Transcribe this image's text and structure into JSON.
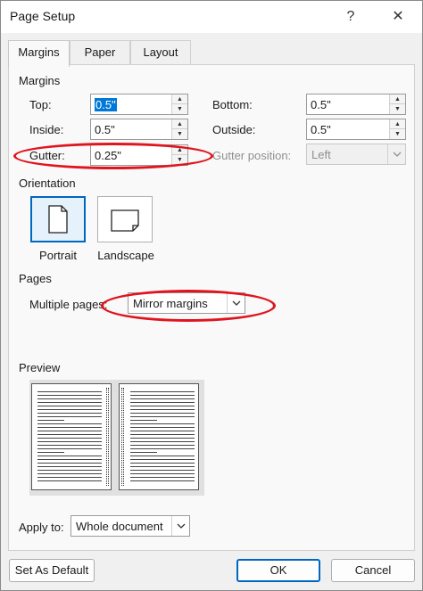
{
  "window": {
    "title": "Page Setup",
    "help_label": "?",
    "close_label": "✕"
  },
  "tabs": [
    {
      "label": "Margins",
      "active": true
    },
    {
      "label": "Paper",
      "active": false
    },
    {
      "label": "Layout",
      "active": false
    }
  ],
  "margins": {
    "section_label": "Margins",
    "top": {
      "label": "Top:",
      "value": "0.5\""
    },
    "bottom": {
      "label": "Bottom:",
      "value": "0.5\""
    },
    "inside": {
      "label": "Inside:",
      "value": "0.5\""
    },
    "outside": {
      "label": "Outside:",
      "value": "0.5\""
    },
    "gutter": {
      "label": "Gutter:",
      "value": "0.25\""
    },
    "gutter_position": {
      "label": "Gutter position:",
      "value": "Left"
    }
  },
  "orientation": {
    "section_label": "Orientation",
    "portrait_label": "Portrait",
    "landscape_label": "Landscape",
    "selected": "Portrait"
  },
  "pages": {
    "section_label": "Pages",
    "multiple_pages_label": "Multiple pages:",
    "multiple_pages_value": "Mirror margins"
  },
  "preview": {
    "section_label": "Preview"
  },
  "apply_to": {
    "label": "Apply to:",
    "value": "Whole document"
  },
  "buttons": {
    "set_default": "Set As Default",
    "ok": "OK",
    "cancel": "Cancel"
  },
  "colors": {
    "accent": "#0067c0",
    "selection": "#0078d7",
    "annotation": "#e0141e"
  }
}
